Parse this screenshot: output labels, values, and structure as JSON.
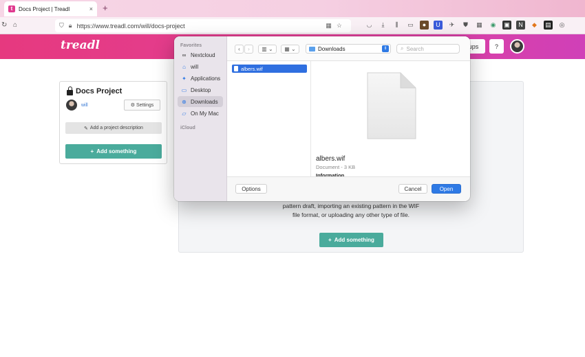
{
  "browser": {
    "tab_title": "Docs Project | Treadl",
    "tab_close": "×",
    "new_tab": "+",
    "url": "https://www.treadl.com/will/docs-project",
    "favicon_letter": "t"
  },
  "site": {
    "logo": "treadl",
    "header_button": "ups",
    "help_button": "?"
  },
  "project": {
    "title": "Docs Project",
    "owner": "will",
    "settings_label": "Settings",
    "description_label": "Add a project description",
    "add_label": "Add something"
  },
  "main_panel": {
    "text": "pattern draft, importing an existing pattern in the WIF file format, or uploading any other type of file.",
    "add_label": "Add something"
  },
  "dialog": {
    "sidebar": {
      "favorites_label": "Favorites",
      "items": [
        {
          "label": "Nextcloud",
          "icon": "cloud-icon"
        },
        {
          "label": "will",
          "icon": "home-icon"
        },
        {
          "label": "Applications",
          "icon": "applications-icon"
        },
        {
          "label": "Desktop",
          "icon": "desktop-icon"
        },
        {
          "label": "Downloads",
          "icon": "downloads-icon"
        },
        {
          "label": "On My Mac",
          "icon": "folder-icon"
        }
      ],
      "icloud_label": "iCloud"
    },
    "location": "Downloads",
    "search_placeholder": "Search",
    "files": [
      {
        "name": "albers.wif",
        "selected": true
      }
    ],
    "preview": {
      "name": "albers.wif",
      "meta": "Document - 3 KB",
      "info": "Information"
    },
    "options_label": "Options",
    "cancel_label": "Cancel",
    "open_label": "Open"
  }
}
